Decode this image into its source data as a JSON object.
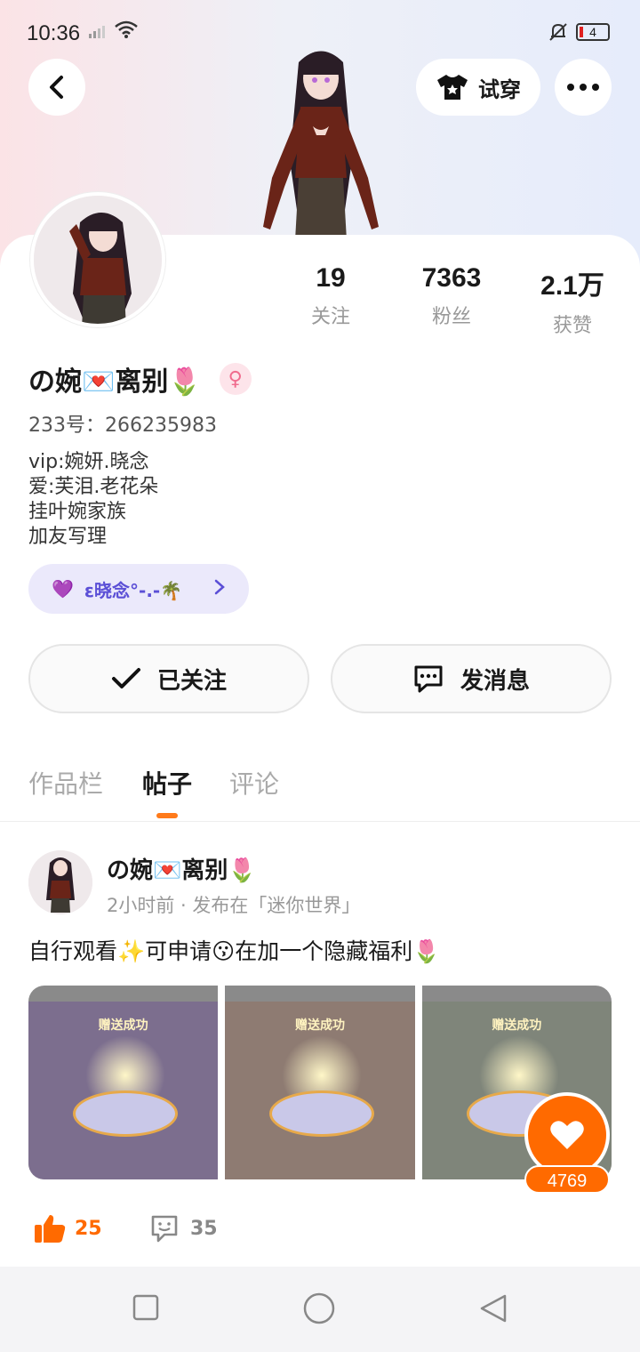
{
  "status_bar": {
    "time": "10:36",
    "battery": "4"
  },
  "header": {
    "tryon_label": "试穿"
  },
  "profile": {
    "stats": [
      {
        "num": "19",
        "label": "关注"
      },
      {
        "num": "7363",
        "label": "粉丝"
      },
      {
        "num": "2.1万",
        "label": "获赞"
      }
    ],
    "name": "の婉💌离别🌷",
    "gender_symbol": "♀",
    "uid": "233号：266235983",
    "bio": [
      "vip:婉妍.晓念",
      "爱:芙泪.老花朵",
      "挂叶婉家族",
      "加友写理"
    ],
    "tag": {
      "heart": "💜",
      "text": "ε晓念°-.-🌴"
    },
    "follow_label": "已关注",
    "message_label": "发消息"
  },
  "tabs": [
    "作品栏",
    "帖子",
    "评论"
  ],
  "active_tab": "帖子",
  "post": {
    "author": "の婉💌离别🌷",
    "meta": "2小时前 · 发布在「迷你世界」",
    "text": "自行观看✨可申请😗在加一个隐藏福利🌷",
    "thumb_banner": "赠送成功",
    "likes": "25",
    "comments": "35",
    "fab_count": "4769"
  },
  "colors": {
    "accent": "#ff6a00",
    "tag_bg": "#ebe9fb",
    "tag_text": "#5b4fd6"
  }
}
